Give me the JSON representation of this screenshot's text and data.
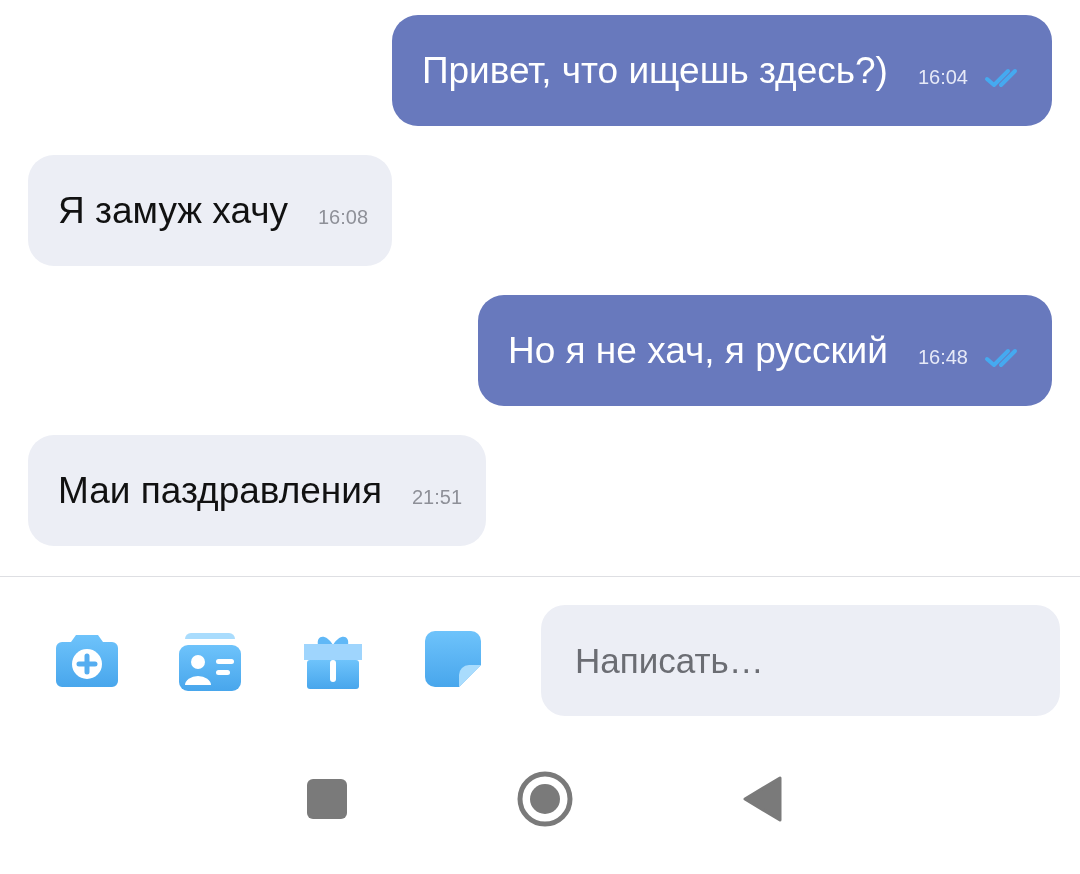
{
  "messages": [
    {
      "kind": "out",
      "text": "Привет, что ищешь здесь?)",
      "time": "16:04",
      "read": true
    },
    {
      "kind": "in",
      "text": "Я замуж хачу",
      "time": "16:08"
    },
    {
      "kind": "out",
      "text": "Но я не хач, я русский",
      "time": "16:48",
      "read": true
    },
    {
      "kind": "in",
      "text": "Маи паздравления",
      "time": "21:51"
    }
  ],
  "composer": {
    "placeholder": "Написать…"
  }
}
